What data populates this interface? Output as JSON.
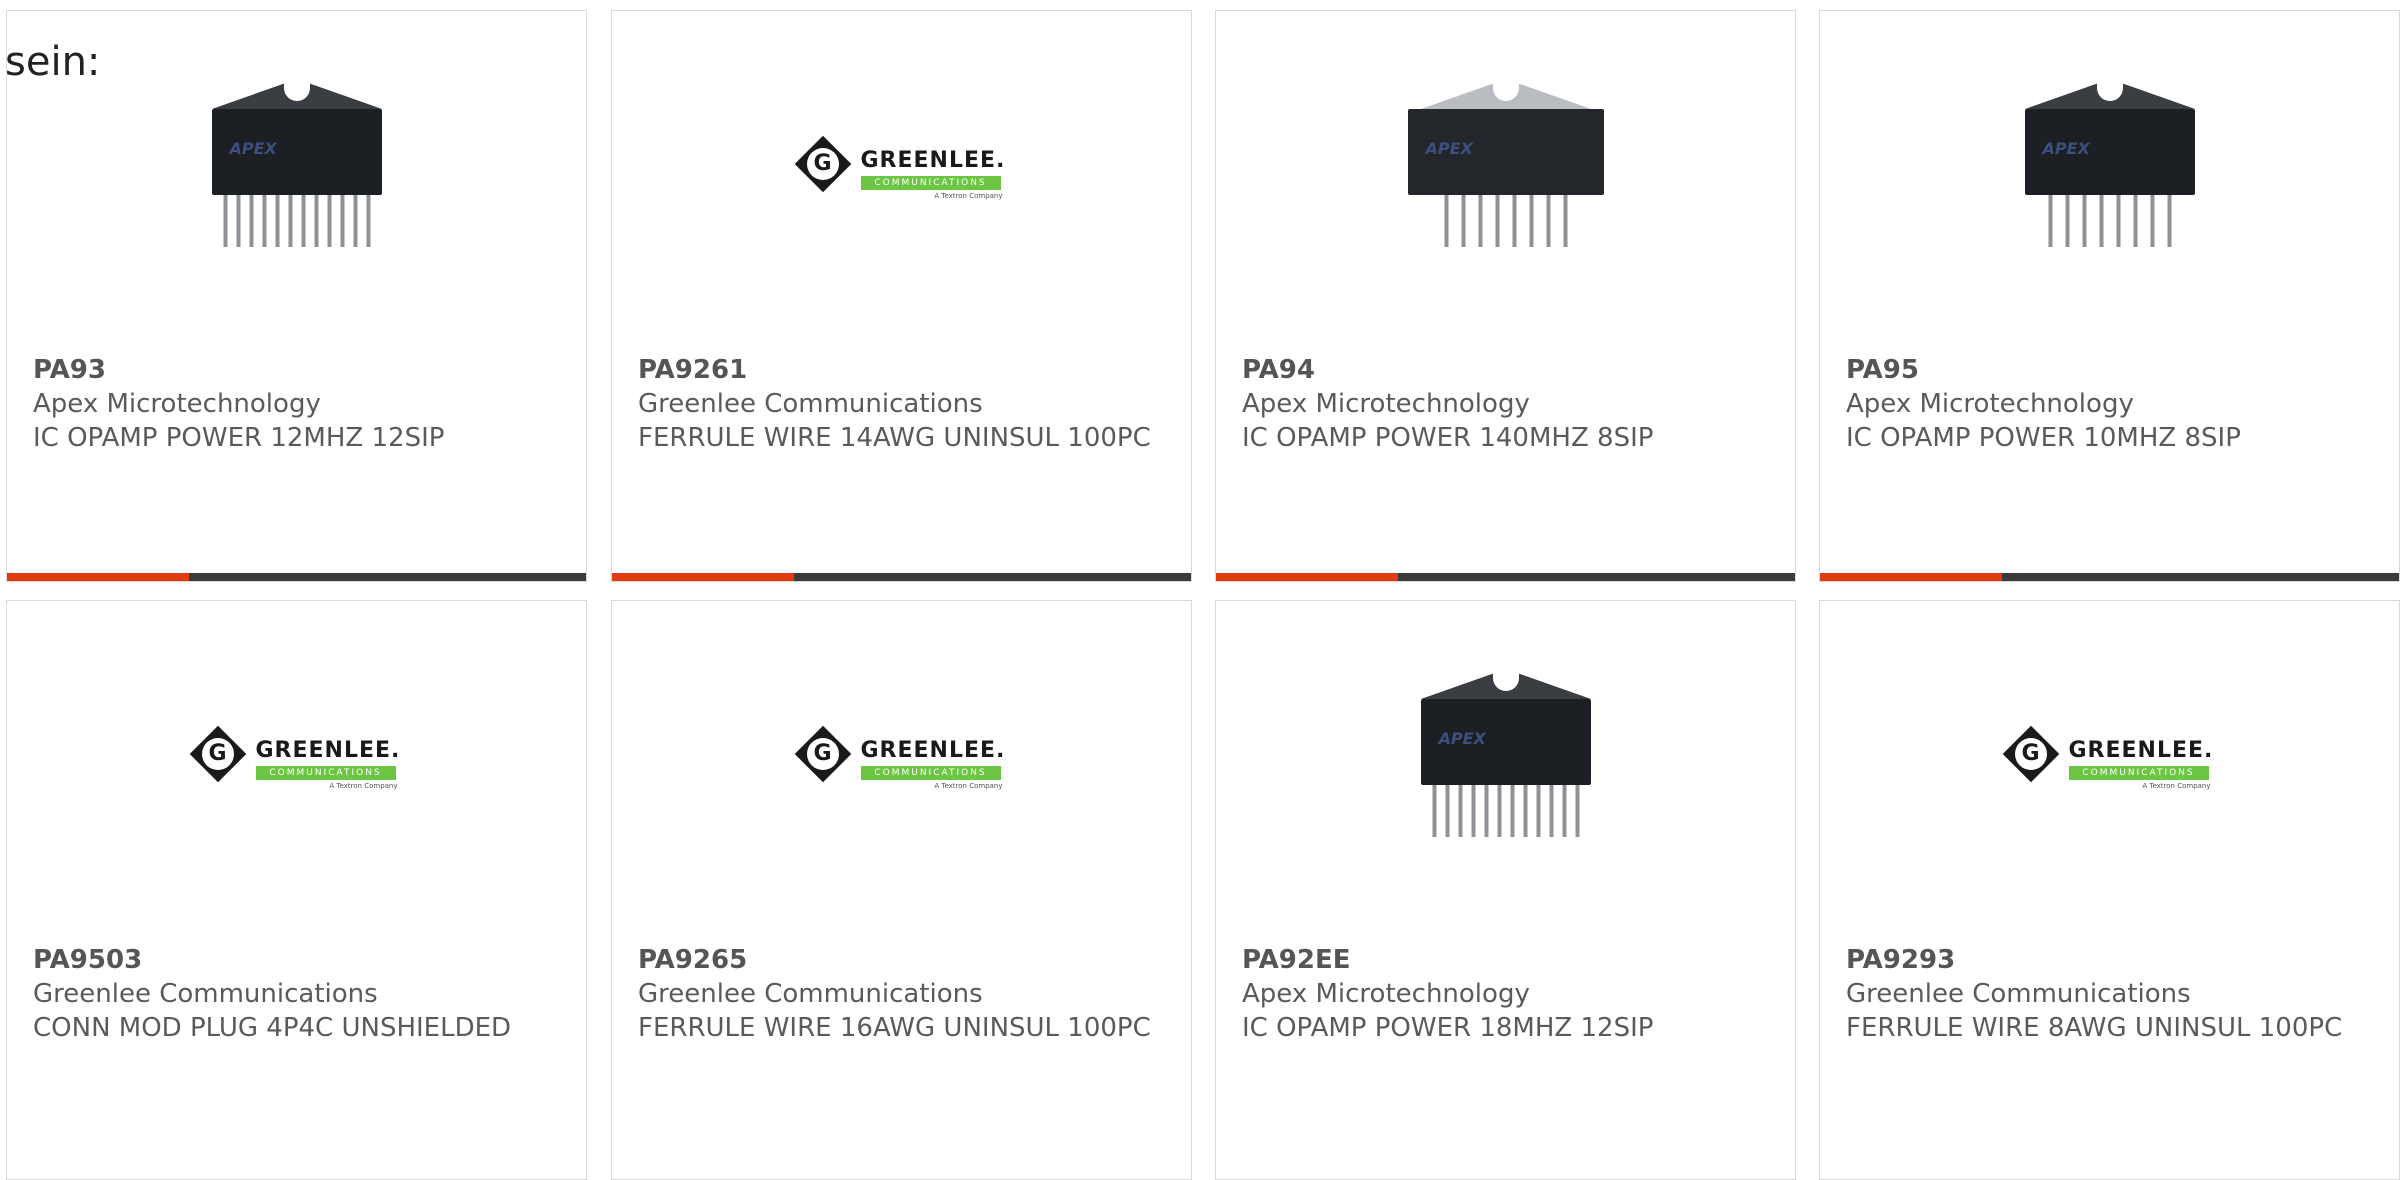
{
  "intro_text": "sein:",
  "colors": {
    "accent_bar": "#e23b12",
    "bar": "#3b3b3b",
    "border": "#d9d9d9"
  },
  "products": [
    {
      "part_number": "PA93",
      "manufacturer": "Apex Microtechnology",
      "description": "IC OPAMP POWER 12MHZ 12SIP",
      "image": "ic-chip-icon",
      "chip_logo": "APEX"
    },
    {
      "part_number": "PA9261",
      "manufacturer": "Greenlee Communications",
      "description": "FERRULE WIRE 14AWG UNINSUL 100PC",
      "image": "greenlee-logo",
      "logo_word": "GREENLEE.",
      "logo_strip": "COMMUNICATIONS",
      "logo_sub": "A Textron Company"
    },
    {
      "part_number": "PA94",
      "manufacturer": "Apex Microtechnology",
      "description": "IC OPAMP POWER 140MHZ 8SIP",
      "image": "ic-chip-icon",
      "chip_logo": "APEX"
    },
    {
      "part_number": "PA95",
      "manufacturer": "Apex Microtechnology",
      "description": "IC OPAMP POWER 10MHZ 8SIP",
      "image": "ic-chip-icon",
      "chip_logo": "APEX"
    },
    {
      "part_number": "PA9503",
      "manufacturer": "Greenlee Communications",
      "description": "CONN MOD PLUG 4P4C UNSHIELDED",
      "image": "greenlee-logo",
      "logo_word": "GREENLEE.",
      "logo_strip": "COMMUNICATIONS",
      "logo_sub": "A Textron Company"
    },
    {
      "part_number": "PA9265",
      "manufacturer": "Greenlee Communications",
      "description": "FERRULE WIRE 16AWG UNINSUL 100PC",
      "image": "greenlee-logo",
      "logo_word": "GREENLEE.",
      "logo_strip": "COMMUNICATIONS",
      "logo_sub": "A Textron Company"
    },
    {
      "part_number": "PA92EE",
      "manufacturer": "Apex Microtechnology",
      "description": "IC OPAMP POWER 18MHZ 12SIP",
      "image": "ic-chip-icon",
      "chip_logo": "APEX"
    },
    {
      "part_number": "PA9293",
      "manufacturer": "Greenlee Communications",
      "description": "FERRULE WIRE 8AWG UNINSUL 100PC",
      "image": "greenlee-logo",
      "logo_word": "GREENLEE.",
      "logo_strip": "COMMUNICATIONS",
      "logo_sub": "A Textron Company"
    }
  ]
}
